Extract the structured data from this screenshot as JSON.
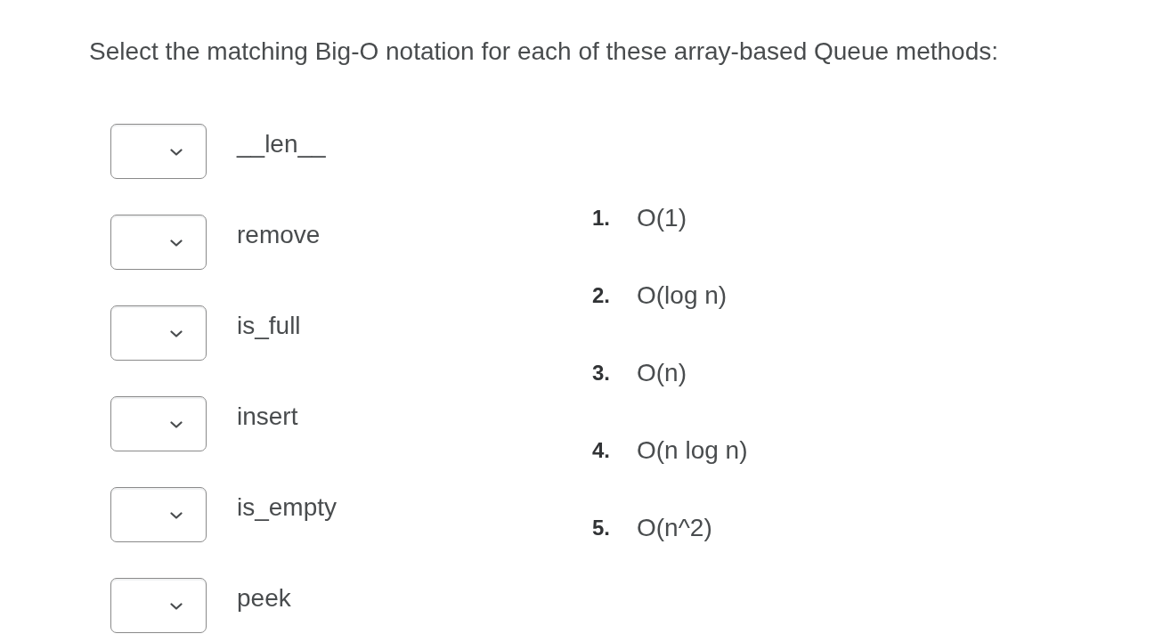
{
  "question": "Select the matching Big-O notation for each of these array-based Queue methods:",
  "matches": [
    {
      "label": "__len__"
    },
    {
      "label": "remove"
    },
    {
      "label": "is_full"
    },
    {
      "label": "insert"
    },
    {
      "label": "is_empty"
    },
    {
      "label": "peek"
    }
  ],
  "choices": [
    {
      "number": "1.",
      "text": "O(1)"
    },
    {
      "number": "2.",
      "text": "O(log n)"
    },
    {
      "number": "3.",
      "text": "O(n)"
    },
    {
      "number": "4.",
      "text": "O(n log n)"
    },
    {
      "number": "5.",
      "text": "O(n^2)"
    }
  ]
}
